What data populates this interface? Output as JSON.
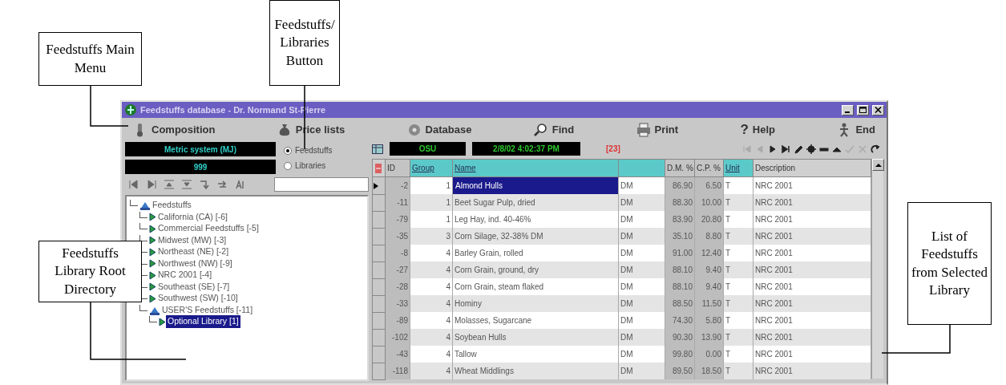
{
  "callouts": [
    {
      "text": "Feedstuffs Main Menu"
    },
    {
      "text": "Feedstuffs/ Libraries Button"
    },
    {
      "text": "Feedstuffs Library Root Directory"
    },
    {
      "text": "List of Feedstuffs from Selected Library"
    }
  ],
  "window": {
    "title": "Feedstuffs database - Dr. Normand St-Pierre"
  },
  "menu": [
    {
      "label": "Composition"
    },
    {
      "label": "Price lists"
    },
    {
      "label": "Database"
    },
    {
      "label": "Find"
    },
    {
      "label": "Print"
    },
    {
      "label": "Help",
      "glyph": "?"
    },
    {
      "label": "End"
    }
  ],
  "unit_system": "Metric system (MJ)",
  "code_display": "999",
  "view_options": [
    {
      "label": "Feedstuffs",
      "selected": true
    },
    {
      "label": "Libraries",
      "selected": false
    }
  ],
  "tree": [
    {
      "label": "Feedstuffs",
      "selected": false,
      "children": [
        {
          "label": "California (CA) [-6]",
          "selected": false
        },
        {
          "label": "Commercial Feedstuffs [-5]",
          "selected": false
        },
        {
          "label": "Midwest (MW) [-3]",
          "selected": false
        },
        {
          "label": "Northeast (NE) [-2]",
          "selected": false
        },
        {
          "label": "Northwest (NW) [-9]",
          "selected": false
        },
        {
          "label": "NRC 2001 [-4]",
          "selected": false
        },
        {
          "label": "Southeast (SE) [-7]",
          "selected": false
        },
        {
          "label": "Southwest (SW) [-10]",
          "selected": false
        },
        {
          "label": "USER'S Feedstuffs [-11]",
          "selected": false,
          "children": [
            {
              "label": "Optional Library [1]",
              "selected": true
            }
          ]
        }
      ]
    }
  ],
  "user": "OSU",
  "timestamp": "2/8/02 4:02:37 PM",
  "record_count": "[23]",
  "record_nav": [
    {
      "disabled": true
    },
    {
      "disabled": true
    },
    {
      "disabled": false
    },
    {
      "disabled": false
    },
    {
      "disabled": false
    },
    {
      "disabled": false
    },
    {
      "disabled": false
    },
    {
      "disabled": false
    },
    {
      "disabled": true
    },
    {
      "disabled": true
    },
    {
      "disabled": false
    }
  ],
  "table": {
    "columns": [
      {
        "label": "ID",
        "highlighted": false,
        "shaded": true
      },
      {
        "label": "Group",
        "highlighted": true,
        "shaded": false
      },
      {
        "label": "Name",
        "highlighted": true,
        "shaded": false
      },
      {
        "highlighted": true,
        "shaded": false
      },
      {
        "label": "D.M. %",
        "highlighted": false,
        "shaded": true
      },
      {
        "label": "C.P. %",
        "highlighted": false,
        "shaded": true
      },
      {
        "label": "Unit",
        "highlighted": true,
        "shaded": false
      },
      {
        "label": "Description",
        "highlighted": false,
        "shaded": false
      }
    ],
    "rows": [
      {
        "selected": true,
        "cells": [
          "-2",
          "1",
          "Almond Hulls",
          "DM",
          "86.90",
          "6.50",
          "T",
          "NRC 2001"
        ]
      },
      {
        "selected": false,
        "cells": [
          "-11",
          "1",
          "Beet Sugar Pulp, dried",
          "DM",
          "88.30",
          "10.00",
          "T",
          "NRC 2001"
        ]
      },
      {
        "selected": false,
        "cells": [
          "-79",
          "1",
          "Leg Hay, ind. 40-46%",
          "DM",
          "83.90",
          "20.80",
          "T",
          "NRC 2001"
        ]
      },
      {
        "selected": false,
        "cells": [
          "-35",
          "3",
          "Corn Silage, 32-38% DM",
          "DM",
          "35.10",
          "8.80",
          "T",
          "NRC 2001"
        ]
      },
      {
        "selected": false,
        "cells": [
          "-8",
          "4",
          "Barley Grain, rolled",
          "DM",
          "91.00",
          "12.40",
          "T",
          "NRC 2001"
        ]
      },
      {
        "selected": false,
        "cells": [
          "-27",
          "4",
          "Corn Grain, ground, dry",
          "DM",
          "88.10",
          "9.40",
          "T",
          "NRC 2001"
        ]
      },
      {
        "selected": false,
        "cells": [
          "-28",
          "4",
          "Corn Grain, steam flaked",
          "DM",
          "88.10",
          "9.40",
          "T",
          "NRC 2001"
        ]
      },
      {
        "selected": false,
        "cells": [
          "-33",
          "4",
          "Hominy",
          "DM",
          "88.50",
          "11.50",
          "T",
          "NRC 2001"
        ]
      },
      {
        "selected": false,
        "cells": [
          "-89",
          "4",
          "Molasses, Sugarcane",
          "DM",
          "74.30",
          "5.80",
          "T",
          "NRC 2001"
        ]
      },
      {
        "selected": false,
        "cells": [
          "-102",
          "4",
          "Soybean Hulls",
          "DM",
          "90.30",
          "13.90",
          "T",
          "NRC 2001"
        ]
      },
      {
        "selected": false,
        "cells": [
          "-43",
          "4",
          "Tallow",
          "DM",
          "99.80",
          "0.00",
          "T",
          "NRC 2001"
        ]
      },
      {
        "selected": false,
        "cells": [
          "-118",
          "4",
          "Wheat Middlings",
          "DM",
          "89.50",
          "18.50",
          "T",
          "NRC 2001"
        ]
      }
    ]
  }
}
